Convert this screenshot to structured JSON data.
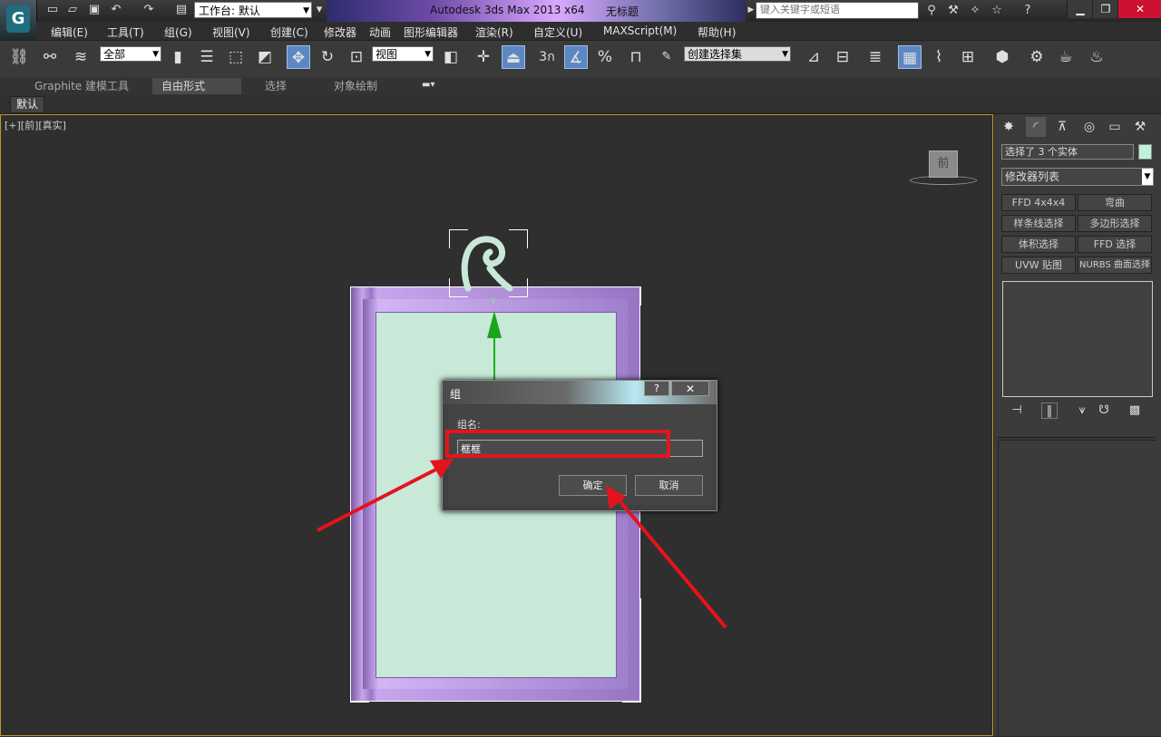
{
  "titlebar": {
    "app_title": "Autodesk 3ds Max  2013 x64",
    "document_title": "无标题",
    "workspace_value": "工作台: 默认",
    "search_placeholder": "键入关键字或短语"
  },
  "menu": {
    "items": [
      "编辑(E)",
      "工具(T)",
      "组(G)",
      "视图(V)",
      "创建(C)",
      "修改器",
      "动画",
      "图形编辑器",
      "渲染(R)",
      "自定义(U)",
      "MAXScript(M)",
      "帮助(H)"
    ]
  },
  "toolbar": {
    "selection_filter": "全部",
    "reference_coord": "视图",
    "snap_label": "3",
    "named_selection_placeholder": "创建选择集"
  },
  "ribbon": {
    "tabs": [
      "Graphite 建模工具",
      "自由形式",
      "选择",
      "对象绘制"
    ],
    "selected_tab": "自由形式",
    "sub_button": "默认"
  },
  "viewport": {
    "label": "[+][前][真实]",
    "viewcube_face": "前",
    "gizmo_axis": "Y"
  },
  "dialog": {
    "title": "组",
    "help_label": "?",
    "close_label": "✕",
    "group_name_label": "组名:",
    "group_name_value": "框框",
    "ok_label": "确定",
    "cancel_label": "取消"
  },
  "command_panel": {
    "selection_info": "选择了 3 个实体",
    "selection_color": "#bff2d8",
    "modifier_list": "修改器列表",
    "modifier_buttons": [
      "FFD 4x4x4",
      "弯曲",
      "样条线选择",
      "多边形选择",
      "体积选择",
      "FFD 选择",
      "UVW 贴图",
      "NURBS 曲面选择"
    ]
  },
  "colors": {
    "highlight": "#e4141c",
    "frame": "#9676c4",
    "canvas": "#c8e8d8",
    "gizmo": "#1aa51a"
  }
}
